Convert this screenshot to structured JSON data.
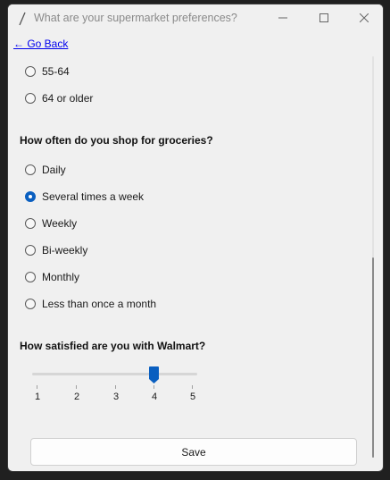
{
  "window": {
    "title": "What are your supermarket preferences?",
    "controls": {
      "minimize_icon": "minimize-icon",
      "maximize_icon": "maximize-icon",
      "close_icon": "close-icon"
    }
  },
  "nav": {
    "back_label": "← Go Back"
  },
  "age_options": {
    "items": [
      {
        "label": "55-64",
        "checked": false
      },
      {
        "label": "64 or older",
        "checked": false
      }
    ]
  },
  "frequency_question": {
    "label": "How often do you shop for groceries?",
    "options": [
      {
        "label": "Daily",
        "checked": false
      },
      {
        "label": "Several times a week",
        "checked": true
      },
      {
        "label": "Weekly",
        "checked": false
      },
      {
        "label": "Bi-weekly",
        "checked": false
      },
      {
        "label": "Monthly",
        "checked": false
      },
      {
        "label": "Less than once a month",
        "checked": false
      }
    ]
  },
  "satisfaction_question": {
    "label": "How satisfied are you with Walmart?",
    "slider": {
      "min": 1,
      "max": 5,
      "value": 4,
      "ticks": [
        "1",
        "2",
        "3",
        "4",
        "5"
      ]
    }
  },
  "actions": {
    "save_label": "Save"
  },
  "colors": {
    "accent": "#0a5fc0",
    "background": "#f0f0f0",
    "link": "#0000ee"
  }
}
